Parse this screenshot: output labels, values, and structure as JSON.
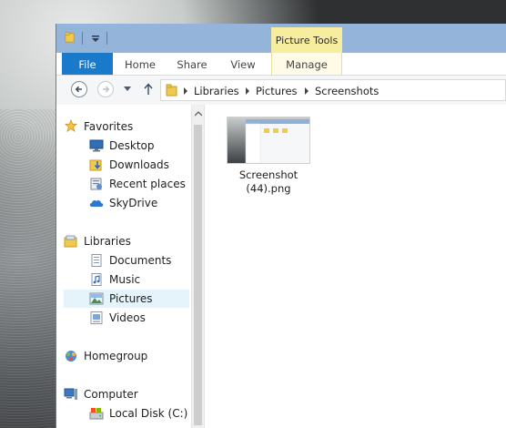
{
  "window": {
    "contextual_tab": "Picture Tools",
    "tabs": [
      "File",
      "Home",
      "Share",
      "View",
      "Manage"
    ]
  },
  "address": {
    "crumbs": [
      "Libraries",
      "Pictures",
      "Screenshots"
    ]
  },
  "navpane": {
    "favorites": {
      "label": "Favorites",
      "items": [
        "Desktop",
        "Downloads",
        "Recent places",
        "SkyDrive"
      ]
    },
    "libraries": {
      "label": "Libraries",
      "items": [
        "Documents",
        "Music",
        "Pictures",
        "Videos"
      ],
      "selected": "Pictures"
    },
    "homegroup": {
      "label": "Homegroup"
    },
    "computer": {
      "label": "Computer",
      "items": [
        "Local Disk (C:)"
      ]
    }
  },
  "files": [
    {
      "name_line1": "Screenshot",
      "name_line2": "(44).png"
    }
  ],
  "colors": {
    "accent": "#1979ca",
    "titlebar": "#94b4d9",
    "contextual": "#f7ed9e",
    "selection": "#e5f3fb"
  }
}
